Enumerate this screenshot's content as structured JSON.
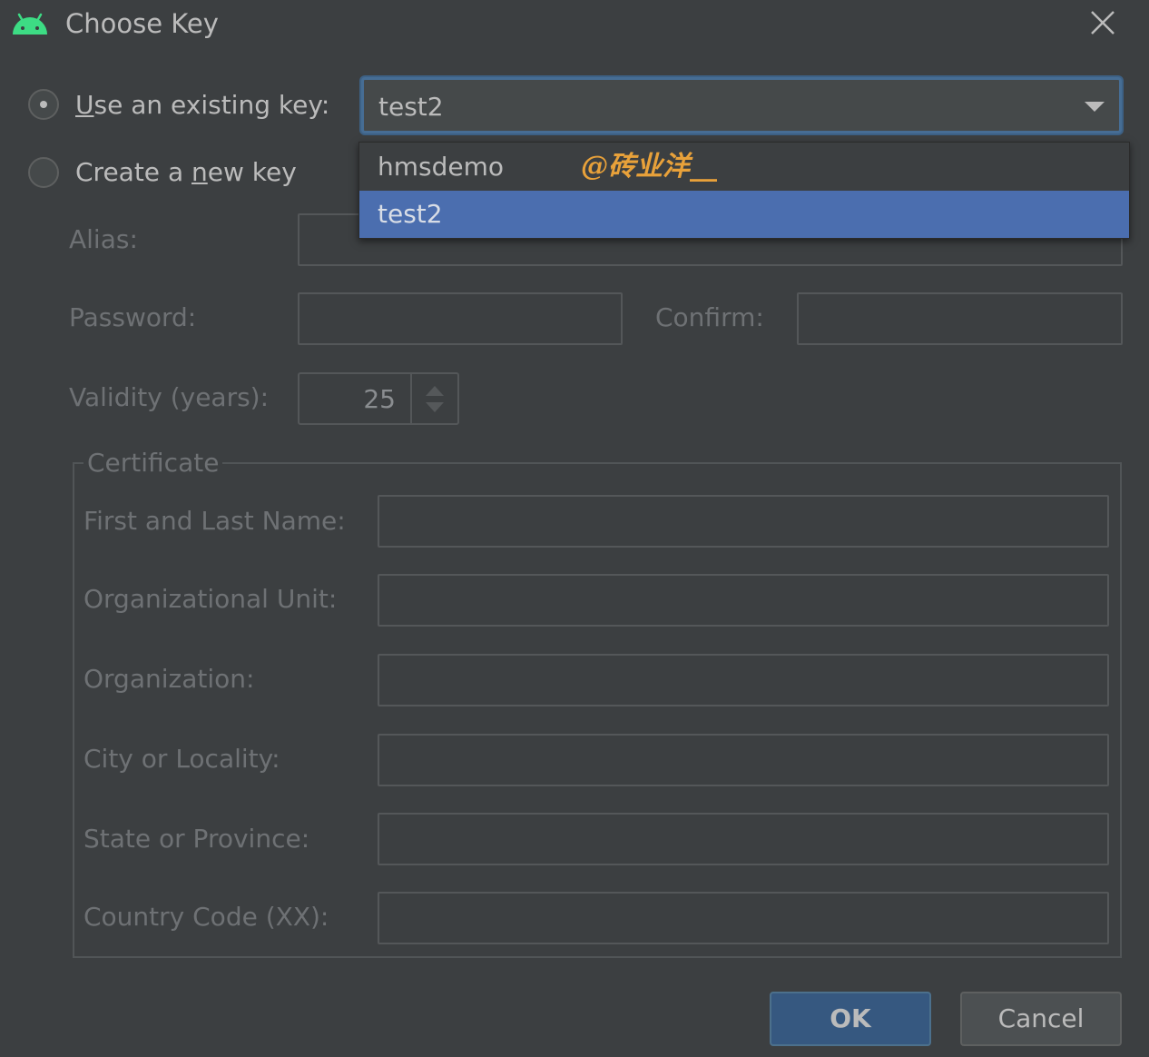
{
  "dialog": {
    "title": "Choose Key",
    "icon": "android-icon"
  },
  "options": {
    "existing_label_prefix": "U",
    "existing_label_rest": "se an existing key:",
    "new_label_prefix": "Create a ",
    "new_label_mnemonic": "n",
    "new_label_rest": "ew key",
    "selected": "existing"
  },
  "key_combo": {
    "value": "test2",
    "options": [
      "hmsdemo",
      "test2"
    ],
    "selected_option": "test2"
  },
  "watermark": "@砖业洋__",
  "new_key": {
    "alias_label": "Alias:",
    "password_label": "Password:",
    "confirm_label": "Confirm:",
    "validity_label": "Validity (years):",
    "validity_value": "25"
  },
  "certificate": {
    "title": "Certificate",
    "fields": [
      "First and Last Name:",
      "Organizational Unit:",
      "Organization:",
      "City or Locality:",
      "State or Province:",
      "Country Code (XX):"
    ]
  },
  "buttons": {
    "ok": "OK",
    "cancel": "Cancel"
  },
  "colors": {
    "background": "#3c3f41",
    "selection": "#4b6eaf",
    "focus_border": "#466d94",
    "android_green": "#3ddc84",
    "watermark": "#e8a13a"
  }
}
